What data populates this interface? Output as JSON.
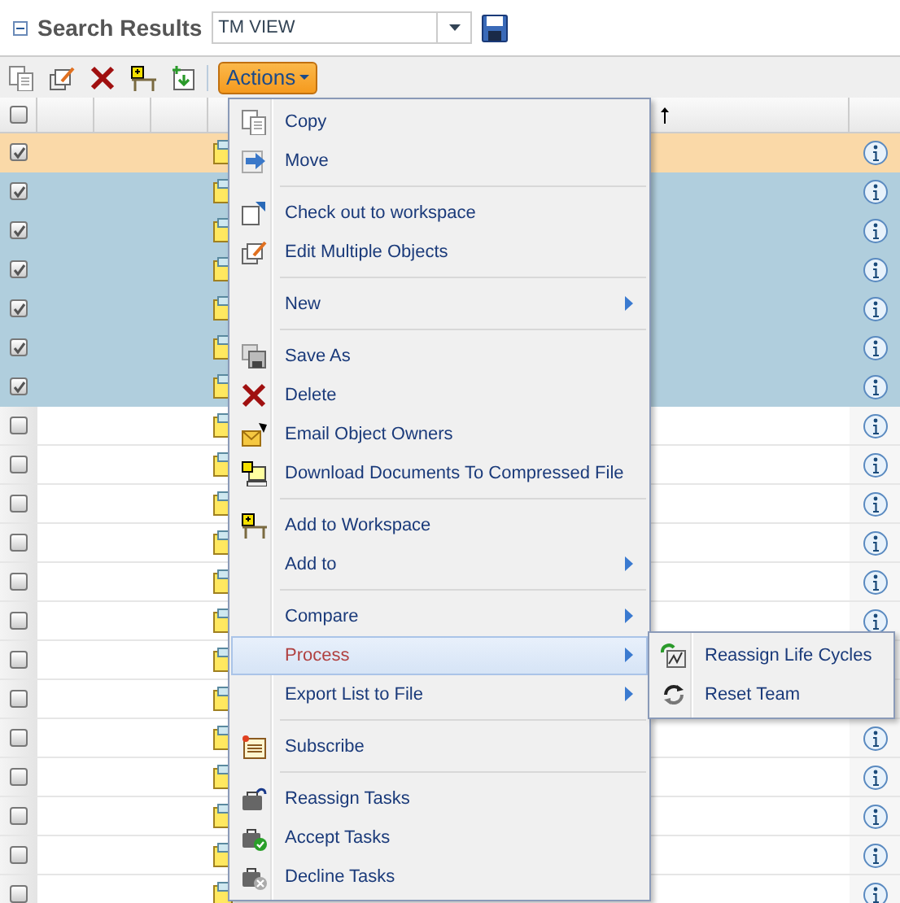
{
  "header": {
    "title": "Search Results",
    "view_select": {
      "value": "TM VIEW"
    }
  },
  "toolbar": {
    "actions_button": "Actions"
  },
  "grid": {
    "select_all_checked": false,
    "rows": [
      {
        "selected": true,
        "current": true
      },
      {
        "selected": true,
        "current": false
      },
      {
        "selected": true,
        "current": false
      },
      {
        "selected": true,
        "current": false
      },
      {
        "selected": true,
        "current": false
      },
      {
        "selected": true,
        "current": false
      },
      {
        "selected": true,
        "current": false
      },
      {
        "selected": false,
        "current": false
      },
      {
        "selected": false,
        "current": false
      },
      {
        "selected": false,
        "current": false
      },
      {
        "selected": false,
        "current": false
      },
      {
        "selected": false,
        "current": false
      },
      {
        "selected": false,
        "current": false
      },
      {
        "selected": false,
        "current": false
      },
      {
        "selected": false,
        "current": false
      },
      {
        "selected": false,
        "current": false
      },
      {
        "selected": false,
        "current": false
      },
      {
        "selected": false,
        "current": false
      },
      {
        "selected": false,
        "current": false
      },
      {
        "selected": false,
        "current": false
      }
    ]
  },
  "actions_menu": {
    "items": [
      {
        "kind": "item",
        "label": "Copy",
        "submenu": false,
        "selected": false
      },
      {
        "kind": "item",
        "label": "Move",
        "submenu": false,
        "selected": false
      },
      {
        "kind": "separator"
      },
      {
        "kind": "item",
        "label": "Check out to workspace",
        "submenu": false,
        "selected": false
      },
      {
        "kind": "item",
        "label": "Edit Multiple Objects",
        "submenu": false,
        "selected": false
      },
      {
        "kind": "separator"
      },
      {
        "kind": "item",
        "label": "New",
        "submenu": true,
        "selected": false
      },
      {
        "kind": "separator"
      },
      {
        "kind": "item",
        "label": "Save As",
        "submenu": false,
        "selected": false
      },
      {
        "kind": "item",
        "label": "Delete",
        "submenu": false,
        "selected": false
      },
      {
        "kind": "item",
        "label": "Email Object Owners",
        "submenu": false,
        "selected": false
      },
      {
        "kind": "item",
        "label": "Download Documents To Compressed File",
        "submenu": false,
        "selected": false
      },
      {
        "kind": "separator"
      },
      {
        "kind": "item",
        "label": "Add to Workspace",
        "submenu": false,
        "selected": false
      },
      {
        "kind": "item",
        "label": "Add to",
        "submenu": true,
        "selected": false
      },
      {
        "kind": "separator"
      },
      {
        "kind": "item",
        "label": "Compare",
        "submenu": true,
        "selected": false
      },
      {
        "kind": "item",
        "label": "Process",
        "submenu": true,
        "selected": true
      },
      {
        "kind": "item",
        "label": "Export List to File",
        "submenu": true,
        "selected": false
      },
      {
        "kind": "separator"
      },
      {
        "kind": "item",
        "label": "Subscribe",
        "submenu": false,
        "selected": false
      },
      {
        "kind": "separator"
      },
      {
        "kind": "item",
        "label": "Reassign Tasks",
        "submenu": false,
        "selected": false
      },
      {
        "kind": "item",
        "label": "Accept Tasks",
        "submenu": false,
        "selected": false
      },
      {
        "kind": "item",
        "label": "Decline Tasks",
        "submenu": false,
        "selected": false
      }
    ]
  },
  "process_submenu": {
    "items": [
      {
        "label": "Reassign Life Cycles"
      },
      {
        "label": "Reset Team"
      }
    ]
  }
}
